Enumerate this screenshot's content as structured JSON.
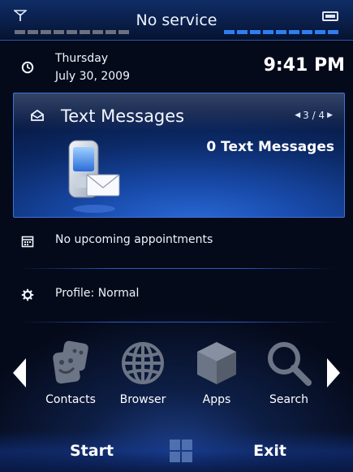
{
  "status": {
    "title": "No service",
    "signal_bars": 9,
    "battery_bars": 9,
    "accent": "#2f7ef0",
    "antenna_icon": "antenna-icon",
    "battery_icon": "battery-icon"
  },
  "datetime": {
    "day": "Thursday",
    "date": "July 30, 2009",
    "time": "9:41 PM",
    "icon": "clock-icon"
  },
  "messages": {
    "title": "Text Messages",
    "pager": "3 / 4",
    "count_label": "0 Text Messages",
    "icon": "inbox-icon"
  },
  "appointments": {
    "text": "No upcoming appointments",
    "icon": "calendar-icon"
  },
  "profile": {
    "text": "Profile: Normal",
    "icon": "gear-icon"
  },
  "launcher": {
    "items": [
      {
        "label": "Contacts",
        "icon": "contacts-icon"
      },
      {
        "label": "Browser",
        "icon": "globe-icon"
      },
      {
        "label": "Apps",
        "icon": "cube-icon"
      },
      {
        "label": "Search",
        "icon": "search-icon"
      }
    ]
  },
  "softkeys": {
    "left": "Start",
    "right": "Exit",
    "center_icon": "windows-icon"
  }
}
